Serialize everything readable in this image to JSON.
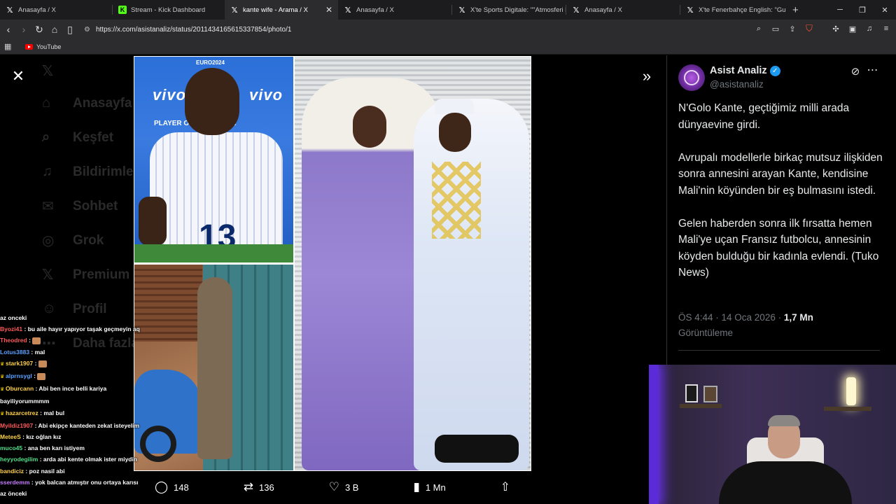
{
  "browser": {
    "tabs": [
      {
        "title": "Anasayfa / X",
        "icon": "x-logo-icon",
        "active": false
      },
      {
        "title": "Stream - Kick Dashboard",
        "icon": "kick-logo-icon",
        "active": false
      },
      {
        "title": "kante wife - Arama / X",
        "icon": "x-logo-icon",
        "active": true
      },
      {
        "title": "Anasayfa / X",
        "icon": "x-logo-icon",
        "active": false
      },
      {
        "title": "X'te Sports Digitale: \"\"Atmosferi beğ",
        "icon": "x-logo-icon",
        "active": false
      },
      {
        "title": "Anasayfa / X",
        "icon": "x-logo-icon",
        "active": false
      },
      {
        "title": "X'te Fenerbahçe English: \"Guendouz",
        "icon": "x-logo-icon",
        "active": false
      }
    ],
    "url": "https://x.com/asistanaliz/status/2011434165615337854/photo/1",
    "bookmarks": [
      {
        "label": "YouTube",
        "icon": "youtube-icon"
      }
    ]
  },
  "background_nav": [
    "Anasayfa",
    "Keşfet",
    "Bildirimler",
    "Sohbet",
    "Grok",
    "Premium",
    "Profil",
    "Daha fazla"
  ],
  "media_actions": {
    "replies": "148",
    "reposts": "136",
    "likes": "3 B",
    "views": "1 Mn"
  },
  "tweet": {
    "display_name": "Asist Analiz",
    "handle": "@asistanaliz",
    "paragraphs": [
      "N'Golo Kante, geçtiğimiz milli arada dünyaevine girdi.",
      "Avrupalı modellerle birkaç mutsuz ilişkiden sonra annesini arayan Kante, kendisine Mali'nin köyünden bir eş bulmasını istedi.",
      "Gelen haberden sonra ilk fırsatta hemen Mali'ye uçan Fransız futbolcu, annesinin köyden bulduğu bir kadınla evlendi. (Tuko News)"
    ],
    "time": "ÖS 4:44 · 14 Oca 2026 ·",
    "views": "1,7 Mn",
    "views_label": "Görüntüleme"
  },
  "photo_text": {
    "sponsor": "vivo",
    "board": "PLAYER OF THE MATCH",
    "event": "EURO2024",
    "shirt_number": "13"
  },
  "chat": [
    {
      "user": "",
      "text": "az onceki"
    },
    {
      "user": "Byozi41",
      "color": "#ff5a5a",
      "text": "bu aile hayır yapıyor taşak geçmeyin aq"
    },
    {
      "user": "Theodred",
      "color": "#ff5a5a",
      "text": "",
      "emote": true
    },
    {
      "user": "Lotus3883",
      "color": "#5aa0ff",
      "text": "mal"
    },
    {
      "user": "stark1907",
      "color": "#ffd24a",
      "text": "",
      "badge": true,
      "emote": true
    },
    {
      "user": "alprnsygl",
      "color": "#5aa0ff",
      "text": "",
      "badge": true,
      "emote": true
    },
    {
      "user": "Oburcann",
      "color": "#ffd24a",
      "text": "Abi ben ince belli kariya",
      "badge": true
    },
    {
      "user": "",
      "text": "bayiliyorummmm"
    },
    {
      "user": "hazarcetrez",
      "color": "#ffd24a",
      "text": "mal bul",
      "badge": true
    },
    {
      "user": "Myildiz1907",
      "color": "#ff5a5a",
      "text": "Abi ekipçe kanteden zekat isteyelim"
    },
    {
      "user": "MeteeS",
      "color": "#ffd24a",
      "text": "kız oğlan kız"
    },
    {
      "user": "muco45",
      "color": "#4ee08a",
      "text": "ana ben karı istiyem"
    },
    {
      "user": "heyyodegilim",
      "color": "#4ee08a",
      "text": "arda abi kente olmak ister miydin"
    },
    {
      "user": "bandiciz",
      "color": "#ffd24a",
      "text": "poz nasil abi"
    },
    {
      "user": "sserdemm",
      "color": "#c77dff",
      "text": "yok balcan atmıştır onu ortaya karısı"
    },
    {
      "user": "",
      "text": "az önceki"
    }
  ]
}
